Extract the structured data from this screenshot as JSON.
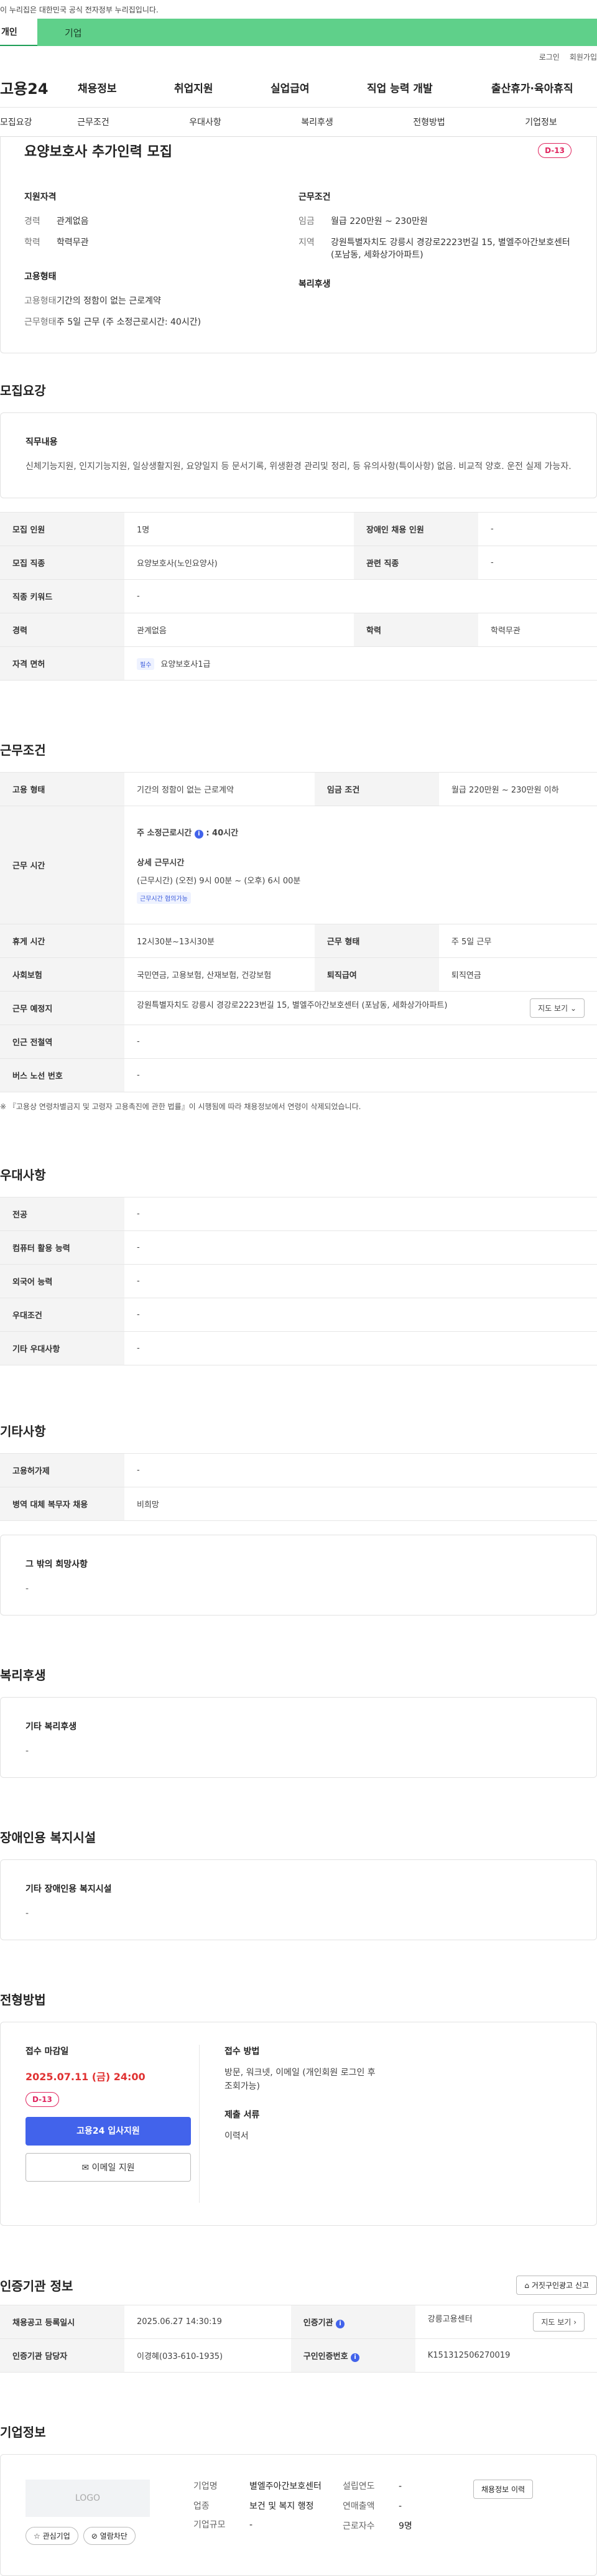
{
  "topbar": {
    "notice": "이 누리집은 대한민국 공식 전자정부 누리집입니다."
  },
  "roles": {
    "person": "개인",
    "corp": "기업"
  },
  "util": {
    "login": "로그인",
    "signup": "회원가입"
  },
  "gnb": {
    "logo": "고용24",
    "items": [
      "채용정보",
      "취업지원",
      "실업급여",
      "직업 능력 개발",
      "출산휴가·육아휴직"
    ]
  },
  "tabs": [
    "모집요강",
    "근무조건",
    "우대사항",
    "복리후생",
    "전형방법",
    "기업정보"
  ],
  "summary": {
    "title": "요양보호사 추가인력 모집",
    "dday": "D-13",
    "qual_h": "지원자격",
    "career_k": "경력",
    "career_v": "관계없음",
    "edu_k": "학력",
    "edu_v": "학력무관",
    "cond_h": "근무조건",
    "wage_k": "임금",
    "wage_v": "월급 220만원 ~ 230만원",
    "area_k": "지역",
    "area_v": "강원특별자치도 강릉시 경강로2223번길 15, 별엘주아간보호센터 (포남동, 세화상가아파트)",
    "emp_h": "고용형태",
    "emptype_k": "고용형태",
    "emptype_v": "기간의 정함이 없는 근로계약",
    "worktype_k": "근무형태",
    "worktype_v": "주 5일 근무 (주 소정근로시간: 40시간)",
    "welfare_h": "복리후생"
  },
  "recruit": {
    "title": "모집요강",
    "duty_h": "직무내용",
    "duty_v": "신체기능지원, 인지기능지원, 일상생활지원, 요양일지 등 문서기록, 위생환경 관리및 정리, 등 유의사항(특이사항) 없음. 비교적 양호. 운전 실제 가능자.",
    "rows": [
      [
        "모집 인원",
        "1명",
        "장애인 채용 인원",
        "-"
      ],
      [
        "모집 직종",
        "요양보호사(노인요양사)",
        "관련 직종",
        "-"
      ],
      [
        "직종 키워드",
        "-"
      ],
      [
        "경력",
        "관계없음",
        "학력",
        "학력무관"
      ],
      [
        "자격 면허",
        "요양보호사1급"
      ]
    ],
    "req_badge": "필수"
  },
  "workcond": {
    "title": "근무조건",
    "emptype_k": "고용 형태",
    "emptype_v": "기간의 정함이 없는 근로계약",
    "wage_k": "임금 조건",
    "wage_v": "월급 220만원 ~ 230만원 이하",
    "hours_k": "근무 시간",
    "hours_l1": "주 소정근로시간",
    "hours_l1v": ": 40시간",
    "hours_l2": "상세 근무시간",
    "hours_l3": "(근무시간) (오전) 9시 00분 ~ (오후) 6시 00분",
    "hours_badge": "근무시간 협의가능",
    "break_k": "휴게 시간",
    "break_v": "12시30분~13시30분",
    "worktype_k": "근무 형태",
    "worktype_v": "주 5일 근무",
    "ins_k": "사회보험",
    "ins_v": "국민연금, 고용보험, 산재보험, 건강보험",
    "retire_k": "퇴직급여",
    "retire_v": "퇴직연금",
    "place_k": "근무 예정지",
    "place_v": "강원특별자치도 강릉시 경강로2223번길 15, 별엘주아간보호센터 (포남동, 세화상가아파트)",
    "map_btn": "지도 보기",
    "station_k": "인근 전철역",
    "station_v": "-",
    "bus_k": "버스 노선 번호",
    "bus_v": "-",
    "note": "※ 『고용상 연령차별금지 및 고령자 고용촉진에 관한 법률』이 시행됨에 따라 채용정보에서 연령이 삭제되었습니다."
  },
  "pref": {
    "title": "우대사항",
    "rows": [
      [
        "전공",
        "-"
      ],
      [
        "컴퓨터 활용 능력",
        "-"
      ],
      [
        "외국어 능력",
        "-"
      ],
      [
        "우대조건",
        "-"
      ],
      [
        "기타 우대사항",
        "-"
      ]
    ]
  },
  "etc": {
    "title": "기타사항",
    "rows": [
      [
        "고용허가제",
        "-"
      ],
      [
        "병역 대체 복무자 채용",
        "비희망"
      ]
    ],
    "other_h": "그 밖의 희망사항",
    "other_v": "-"
  },
  "welfare": {
    "title": "복리후생",
    "h": "기타 복리후생",
    "v": "-"
  },
  "disabled": {
    "title": "장애인용 복지시설",
    "h": "기타 장애인용 복지시설",
    "v": "-"
  },
  "apply": {
    "title": "전형방법",
    "deadline_h": "접수 마감일",
    "deadline": "2025.07.11 (금) 24:00",
    "dday": "D-13",
    "btn1": "고용24 입사지원",
    "btn2": "이메일 지원",
    "method_h": "접수 방법",
    "method_v": "방문, 워크넷, 이메일 (개인회원 로그인 후 조회가능)",
    "docs_h": "제출 서류",
    "docs_v": "이력서"
  },
  "cert": {
    "title": "인증기관 정보",
    "report_btn": "거짓구인광고 신고",
    "rows": [
      [
        "채용공고 등록일시",
        "2025.06.27 14:30:19",
        "인증기관",
        "강릉고용센터"
      ],
      [
        "인증기관 담당자",
        "이경혜(033-610-1935)",
        "구인인증번호",
        "K151312506270019"
      ]
    ],
    "map_btn": "지도 보기"
  },
  "corp": {
    "title": "기업정보",
    "logo": "LOGO",
    "fav": "관심기업",
    "block": "열람차단",
    "name_k": "기업명",
    "name_v": "별엘주아간보호센터",
    "industry_k": "업종",
    "industry_v": "보건 및 복지 행정",
    "size_k": "기업규모",
    "size_v": "-",
    "year_k": "설립연도",
    "year_v": "-",
    "sales_k": "연매출액",
    "sales_v": "-",
    "emp_k": "근로자수",
    "emp_v": "9명",
    "history_btn": "채용정보 이력"
  }
}
